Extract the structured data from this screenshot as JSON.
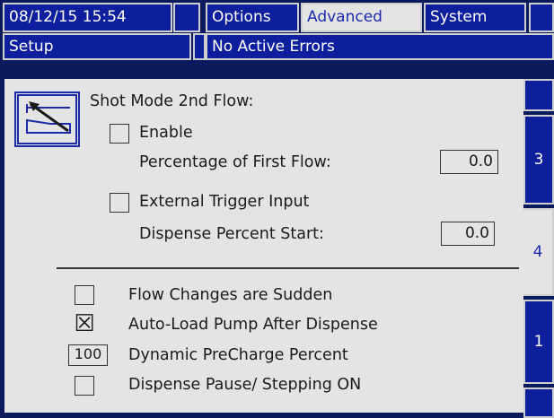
{
  "header": {
    "datetime": "08/12/15 15:54",
    "tabs": [
      "Options",
      "Advanced",
      "System"
    ],
    "active_tab": "Advanced",
    "screen_name": "Setup",
    "status": "No Active Errors"
  },
  "shot_mode": {
    "title": "Shot Mode 2nd Flow:",
    "enable_label": "Enable",
    "enable_checked": false,
    "percentage_label": "Percentage of First Flow:",
    "percentage_value": "0.0",
    "external_trigger_label": "External Trigger Input",
    "external_trigger_checked": false,
    "dispense_start_label": "Dispense Percent Start:",
    "dispense_start_value": "0.0"
  },
  "options": {
    "flow_changes_label": "Flow Changes are Sudden",
    "flow_changes_checked": false,
    "auto_load_label": "Auto-Load Pump After Dispense",
    "auto_load_checked": true,
    "auto_load_mark": "☒",
    "precharge_value": "100",
    "precharge_label": "Dynamic PreCharge Percent",
    "pause_label": "Dispense Pause/ Stepping ON",
    "pause_checked": false
  },
  "side_tabs": [
    "3",
    "4",
    "1"
  ],
  "active_side_tab": "4",
  "colors": {
    "header_blue": "#0d1f9c",
    "panel_gray": "#e4e4e4",
    "active_text": "#1a2aa8"
  }
}
